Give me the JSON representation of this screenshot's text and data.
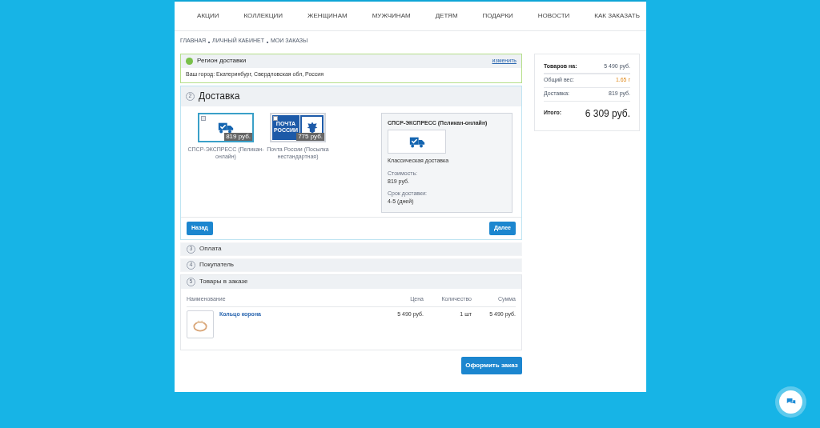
{
  "nav": [
    "АКЦИИ",
    "КОЛЛЕКЦИИ",
    "ЖЕНЩИНАМ",
    "МУЖЧИНАМ",
    "ДЕТЯМ",
    "ПОДАРКИ",
    "НОВОСТИ",
    "КАК ЗАКАЗАТЬ"
  ],
  "breadcrumbs": [
    "ГЛАВНАЯ",
    "ЛИЧНЫЙ КАБИНЕТ",
    "МОИ ЗАКАЗЫ"
  ],
  "region": {
    "title": "Регион доставки",
    "change_link": "изменить",
    "city": "Ваш город: Екатеринбург, Свердловская обл, Россия"
  },
  "delivery": {
    "number": "2",
    "title": "Доставка",
    "options": [
      {
        "kind": "truck",
        "selected": true,
        "price": "819 руб.",
        "label": "СПСР-ЭКСПРЕСС (Пеликан-онлайн)"
      },
      {
        "kind": "post",
        "selected": false,
        "price": "775 руб.",
        "label": "Почта России (Посылка нестандартная)",
        "logo_text": "ПОЧТА РОССИИ"
      }
    ],
    "detail": {
      "title": "СПСР-ЭКСПРЕСС (Пеликан-онлайн)",
      "subtitle": "Классическая доставка",
      "cost_label": "Стоимость:",
      "cost": "819 руб.",
      "time_label": "Срок доставки:",
      "time": "4-5 (дней)"
    },
    "back_button": "Назад",
    "next_button": "Далее"
  },
  "steps": [
    {
      "number": "3",
      "title": "Оплата"
    },
    {
      "number": "4",
      "title": "Покупатель"
    }
  ],
  "items": {
    "number": "5",
    "title": "Товары в заказе",
    "columns": [
      "Наименование",
      "Цена",
      "Количество",
      "Сумма"
    ],
    "rows": [
      {
        "name": "Кольцо корона",
        "price": "5 490 руб.",
        "qty": "1 шт",
        "sum": "5 490 руб."
      }
    ]
  },
  "submit_button": "Оформить заказ",
  "summary": {
    "rows": [
      {
        "label": "Товаров на:",
        "value": "5 490 руб.",
        "bold": true,
        "highlight": false
      },
      {
        "label": "Общий вес:",
        "value": "1.65 г",
        "bold": false,
        "highlight": true
      },
      {
        "label": "Доставка:",
        "value": "819 руб.",
        "bold": false,
        "highlight": false
      }
    ],
    "total_label": "Итого:",
    "total": "6 309 руб."
  }
}
